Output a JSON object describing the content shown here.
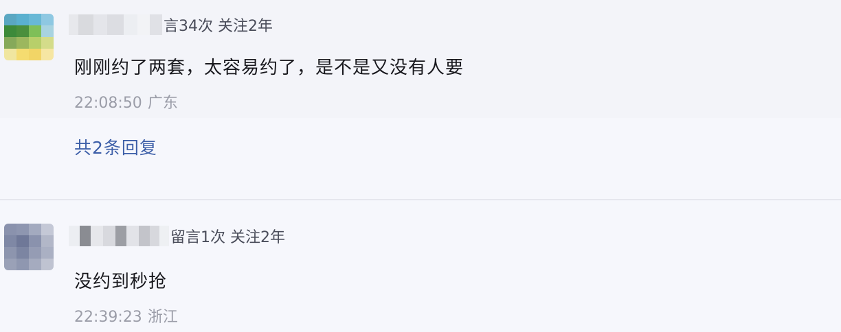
{
  "comments": [
    {
      "meta": "言34次 关注2年",
      "text": "刚刚约了两套，太容易约了，是不是又没有人要",
      "time": "22:08:50",
      "location": "广东",
      "replies_label": "共2条回复"
    },
    {
      "meta": "留言1次 关注2年",
      "text": "没约到秒抢",
      "time": "22:39:23",
      "location": "浙江"
    }
  ],
  "colors": {
    "background": "#f5f6fb",
    "text": "#18181d",
    "meta_text": "#4a4d5a",
    "muted_text": "#9b9da8",
    "link": "#3d5fa8"
  }
}
